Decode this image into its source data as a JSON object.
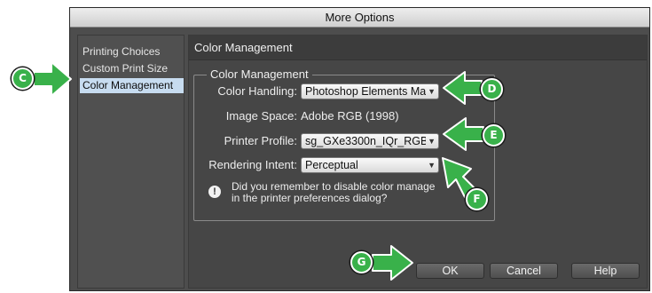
{
  "window": {
    "title": "More Options"
  },
  "sidebar": {
    "items": [
      {
        "label": "Printing Choices",
        "selected": false
      },
      {
        "label": "Custom Print Size",
        "selected": false
      },
      {
        "label": "Color Management",
        "selected": true
      }
    ]
  },
  "main": {
    "header": "Color Management",
    "group_title": "Color Management",
    "color_handling": {
      "label": "Color Handling:",
      "value": "Photoshop Elements Ma"
    },
    "image_space": {
      "label": "Image Space:",
      "value": "Adobe RGB (1998)"
    },
    "printer_profile": {
      "label": "Printer Profile:",
      "value": "sg_GXe3300n_IQr_RGB_"
    },
    "rendering_intent": {
      "label": "Rendering Intent:",
      "value": "Perceptual"
    },
    "note": {
      "icon": "info-icon",
      "line1": "Did you remember to disable color manage",
      "line2": "in the printer preferences dialog?"
    }
  },
  "buttons": {
    "ok": "OK",
    "cancel": "Cancel",
    "help": "Help"
  },
  "callouts": {
    "c": "C",
    "d": "D",
    "e": "E",
    "f": "F",
    "g": "G"
  },
  "colors": {
    "callout": "#39b14a",
    "selection": "#c7dcf0",
    "panel": "#464646"
  }
}
